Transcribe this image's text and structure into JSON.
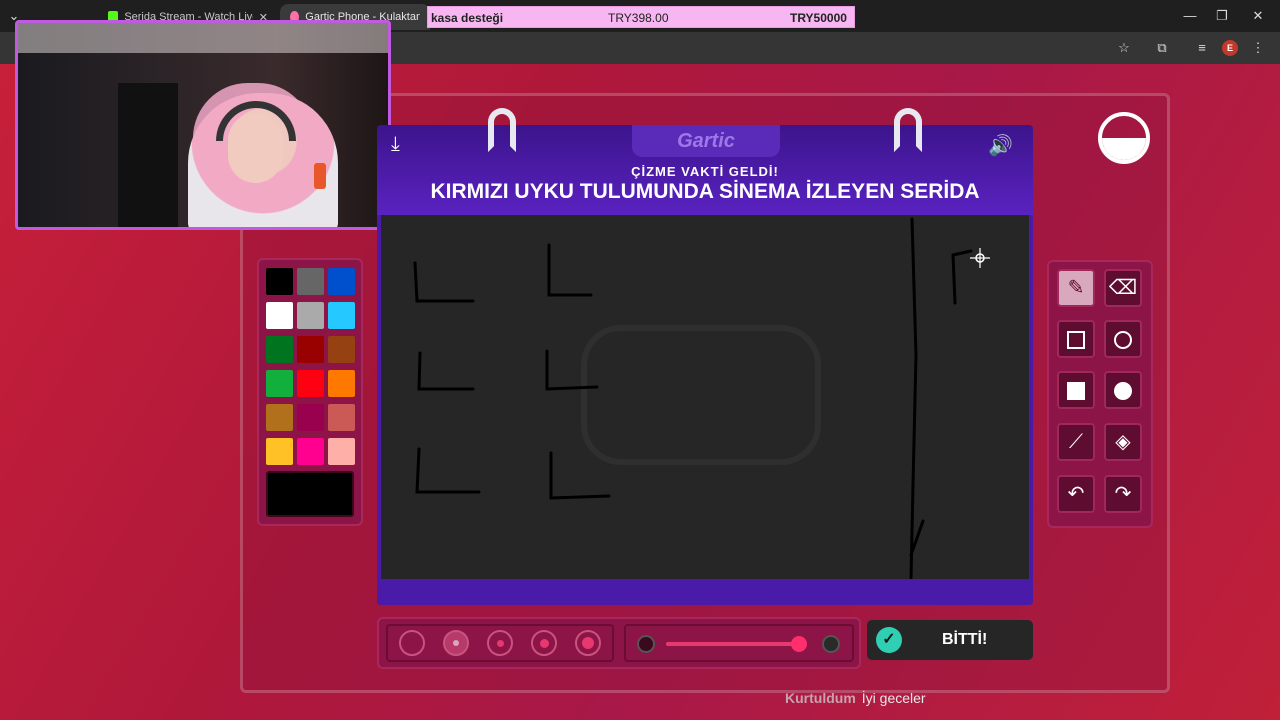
{
  "browser": {
    "tabs": [
      {
        "label": "Serida Stream - Watch Live on",
        "favicon_color": "#53fc18"
      },
      {
        "label": "Gartic Phone - Kulaktan Kulağ",
        "favicon_color": "#ff6fa8"
      }
    ],
    "window_controls": {
      "minimize": "—",
      "maximize": "❐",
      "close": "✕"
    }
  },
  "donation": {
    "text": "kasa desteği",
    "amount": "TRY398.00",
    "goal": "TRY50000"
  },
  "game": {
    "logo": "Gartic",
    "subtitle": "ÇİZME VAKTİ GELDİ!",
    "prompt": "KIRMIZI UYKU TULUMUNDA SİNEMA İZLEYEN SERİDA",
    "timer_remaining": 0.5,
    "palette_colors": [
      "#000000",
      "#666666",
      "#0050cd",
      "#ffffff",
      "#aaaaaa",
      "#26c9ff",
      "#017420",
      "#990000",
      "#964112",
      "#11b03c",
      "#ff0013",
      "#ff7800",
      "#b0701c",
      "#99004e",
      "#cb5a57",
      "#ffc126",
      "#ff008f",
      "#feafa8"
    ],
    "selected_color": "#000000",
    "tools": [
      {
        "name": "pencil",
        "active": true
      },
      {
        "name": "eraser",
        "active": false
      },
      {
        "name": "rectangle",
        "active": false
      },
      {
        "name": "ellipse",
        "active": false
      },
      {
        "name": "filled-rectangle",
        "active": false
      },
      {
        "name": "filled-ellipse",
        "active": false
      },
      {
        "name": "line",
        "active": false
      },
      {
        "name": "fill-bucket",
        "active": false
      },
      {
        "name": "undo",
        "active": false
      },
      {
        "name": "redo",
        "active": false
      }
    ],
    "brush_sizes_selected_index": 1,
    "opacity_level": 0.95,
    "done_label": "BİTTİ!"
  },
  "chat": {
    "user": "Kurtuldum",
    "message": "İyi geceler"
  }
}
